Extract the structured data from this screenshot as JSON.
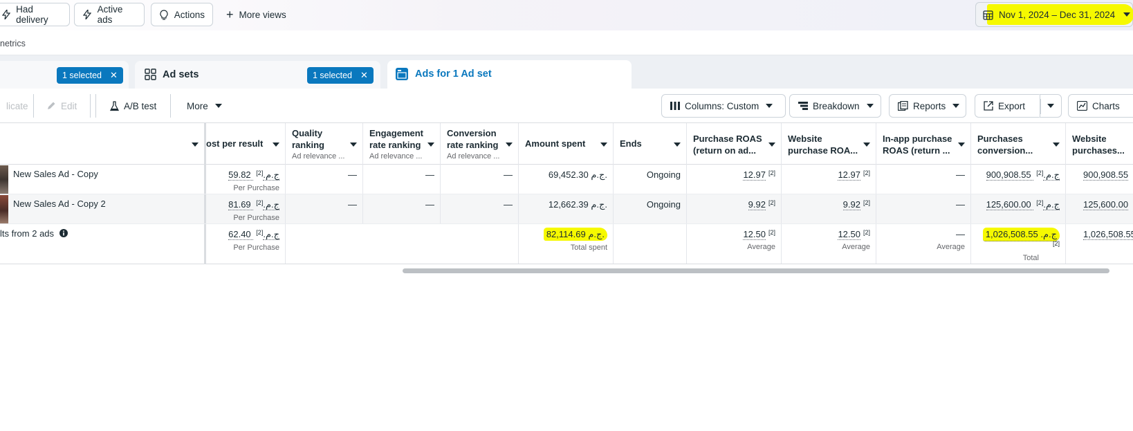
{
  "filters": {
    "had_delivery": "Had delivery",
    "active_ads": "Active ads",
    "actions": "Actions",
    "more_views": "More views",
    "date_range": "Nov 1, 2024 – Dec 31, 2024"
  },
  "subbar": {
    "label": "netrics"
  },
  "tabs": {
    "campaigns_selected": "1 selected",
    "adsets_label": "Ad sets",
    "adsets_selected": "1 selected",
    "ads_label": "Ads for 1 Ad set"
  },
  "toolbar": {
    "duplicate": "licate",
    "edit": "Edit",
    "ab_test": "A/B test",
    "more": "More",
    "columns": "Columns: Custom",
    "breakdown": "Breakdown",
    "reports": "Reports",
    "export": "Export",
    "charts": "Charts"
  },
  "columns": {
    "cost_per_result": "ost per result",
    "quality_ranking": "Quality ranking",
    "quality_sub": "Ad relevance ...",
    "engagement": "Engagement rate ranking",
    "engagement_sub": "Ad relevance ...",
    "conversion": "Conversion rate ranking",
    "conversion_sub": "Ad relevance ...",
    "amount_spent": "Amount spent",
    "ends": "Ends",
    "purchase_roas": "Purchase ROAS (return on ad...",
    "website_roas": "Website purchase ROA...",
    "inapp_roas": "In-app purchase ROAS (return ...",
    "purchases_conv": "Purchases conversion...",
    "website_purchases": "Website purchases..."
  },
  "rows": [
    {
      "name": "New Sales Ad - Copy",
      "cost": "59.82 ج.م.",
      "cost_sub": "Per Purchase",
      "quality": "—",
      "engagement": "—",
      "conversion": "—",
      "amount": "69,452.30 ج.م.",
      "ends": "Ongoing",
      "purchase_roas": "12.97",
      "website_roas": "12.97",
      "inapp_roas": "—",
      "purchases_conv": "900,908.55 ج.م.",
      "website_purchases": "900,908.55"
    },
    {
      "name": "New Sales Ad - Copy 2",
      "cost": "81.69 ج.م.",
      "cost_sub": "Per Purchase",
      "quality": "—",
      "engagement": "—",
      "conversion": "—",
      "amount": "12,662.39 ج.م.",
      "ends": "Ongoing",
      "purchase_roas": "9.92",
      "website_roas": "9.92",
      "inapp_roas": "—",
      "purchases_conv": "125,600.00 ج.م.",
      "website_purchases": "125,600.00"
    }
  ],
  "total": {
    "label": "lts from 2 ads",
    "cost": "62.40 ج.م.",
    "cost_sub": "Per Purchase",
    "amount": "82,114.69 ج.م.",
    "amount_sub": "Total spent",
    "purchase_roas": "12.50",
    "purchase_roas_sub": "Average",
    "website_roas": "12.50",
    "website_roas_sub": "Average",
    "inapp_roas": "—",
    "inapp_roas_sub": "Average",
    "purchases_conv": "1,026,508.55 ج.م.",
    "purchases_conv_sub": "Total",
    "website_purchases": "1,026,508.55"
  },
  "footnote_marker": "[2]",
  "colors": {
    "accent": "#0a78be",
    "highlight": "#f6f900"
  }
}
